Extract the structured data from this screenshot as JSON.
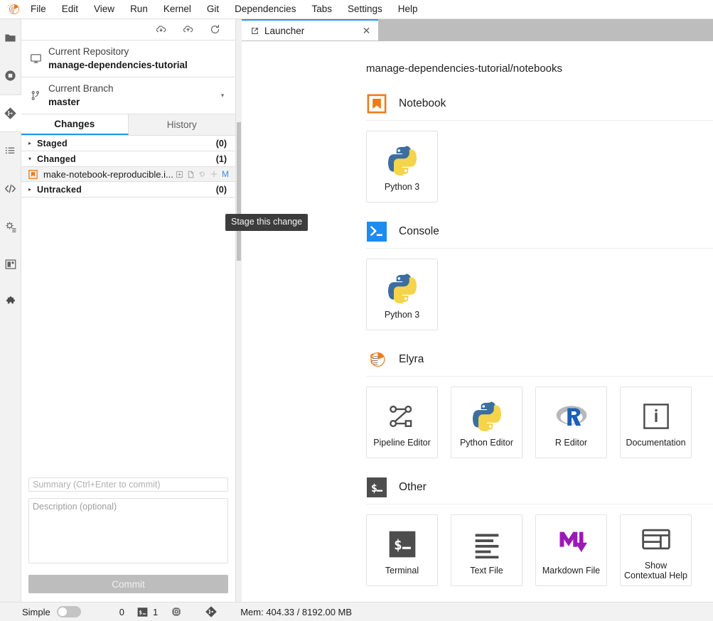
{
  "app": {
    "logo_icon": "jupyter-logo-icon",
    "menu": [
      "File",
      "Edit",
      "View",
      "Run",
      "Kernel",
      "Git",
      "Dependencies",
      "Tabs",
      "Settings",
      "Help"
    ]
  },
  "activity_bar": {
    "items": [
      {
        "name": "file-browser",
        "icon": "folder-icon",
        "active": false
      },
      {
        "name": "running-sessions",
        "icon": "stop-circle-icon",
        "active": false
      },
      {
        "name": "git",
        "icon": "git-icon",
        "active": true
      },
      {
        "name": "table-of-contents",
        "icon": "list-icon",
        "active": false
      },
      {
        "name": "debugger",
        "icon": "code-brackets-icon",
        "active": false
      },
      {
        "name": "property-inspector",
        "icon": "gear-lines-icon",
        "active": false
      },
      {
        "name": "extension-panel",
        "icon": "extension-panel-icon",
        "active": false
      },
      {
        "name": "extension-manager",
        "icon": "puzzle-piece-icon",
        "active": false
      }
    ]
  },
  "git_panel": {
    "toolbar": [
      {
        "name": "pull-button",
        "icon": "cloud-download-icon",
        "title": "Pull latest changes"
      },
      {
        "name": "push-button",
        "icon": "cloud-upload-icon",
        "title": "Push committed changes"
      },
      {
        "name": "refresh-button",
        "icon": "refresh-icon",
        "title": "Refresh the repository"
      }
    ],
    "repository": {
      "label": "Current Repository",
      "value": "manage-dependencies-tutorial",
      "icon": "desktop-icon"
    },
    "branch": {
      "label": "Current Branch",
      "value": "master",
      "icon": "branch-icon",
      "caret": "▾"
    },
    "tabs": [
      {
        "label": "Changes",
        "active": true
      },
      {
        "label": "History",
        "active": false
      }
    ],
    "sections": [
      {
        "title": "Staged",
        "count": "(0)",
        "expanded": false,
        "caret": "▸",
        "files": []
      },
      {
        "title": "Changed",
        "count": "(1)",
        "expanded": true,
        "caret": "▾",
        "files": [
          {
            "name": "make-notebook-reproducible.i...",
            "icon": "notebook-file-icon",
            "status": "M",
            "actions": [
              {
                "name": "open-diff-button",
                "icon": "diff-icon"
              },
              {
                "name": "open-file-button",
                "icon": "file-icon"
              },
              {
                "name": "discard-changes-button",
                "icon": "discard-icon"
              },
              {
                "name": "stage-change-button",
                "icon": "plus-icon"
              }
            ]
          }
        ]
      },
      {
        "title": "Untracked",
        "count": "(0)",
        "expanded": false,
        "caret": "▸",
        "files": []
      }
    ],
    "commit": {
      "summary_placeholder": "Summary (Ctrl+Enter to commit)",
      "summary_value": "",
      "description_placeholder": "Description (optional)",
      "description_value": "",
      "button_label": "Commit"
    }
  },
  "tooltip": {
    "text": "Stage this change"
  },
  "main": {
    "tabs": [
      {
        "label": "Launcher",
        "icon": "launcher-icon",
        "active": true,
        "close_glyph": "✕"
      }
    ],
    "launcher": {
      "cwd": "manage-dependencies-tutorial/notebooks",
      "sections": [
        {
          "name": "Notebook",
          "icon": "notebook-section-icon",
          "cards": [
            {
              "label": "Python 3",
              "icon": "python-logo-icon"
            }
          ]
        },
        {
          "name": "Console",
          "icon": "console-section-icon",
          "cards": [
            {
              "label": "Python 3",
              "icon": "python-logo-icon"
            }
          ]
        },
        {
          "name": "Elyra",
          "icon": "elyra-section-icon",
          "cards": [
            {
              "label": "Pipeline Editor",
              "icon": "pipeline-icon"
            },
            {
              "label": "Python Editor",
              "icon": "python-logo-icon"
            },
            {
              "label": "R Editor",
              "icon": "r-logo-icon"
            },
            {
              "label": "Documentation",
              "icon": "info-box-icon"
            }
          ]
        },
        {
          "name": "Other",
          "icon": "other-section-icon",
          "cards": [
            {
              "label": "Terminal",
              "icon": "terminal-icon"
            },
            {
              "label": "Text File",
              "icon": "text-lines-icon"
            },
            {
              "label": "Markdown File",
              "icon": "markdown-icon"
            },
            {
              "label": "Show\nContextual Help",
              "icon": "contextual-help-icon"
            }
          ]
        }
      ]
    }
  },
  "status_bar": {
    "simple_label": "Simple",
    "simple_on": false,
    "kernel_count": "0",
    "terminal_icon": "terminal-small-icon",
    "terminal_count": "1",
    "cpu_icon": "cpu-icon",
    "git_icon": "git-small-icon",
    "memory": "Mem: 404.33 / 8192.00 MB"
  },
  "colors": {
    "accent_blue": "#2196f3",
    "orange": "#ee7a1a",
    "python_blue": "#3c6e9f",
    "python_yellow": "#f5d44c",
    "markdown_purple": "#9b1ab4",
    "status_modified": "#3a8dde"
  }
}
